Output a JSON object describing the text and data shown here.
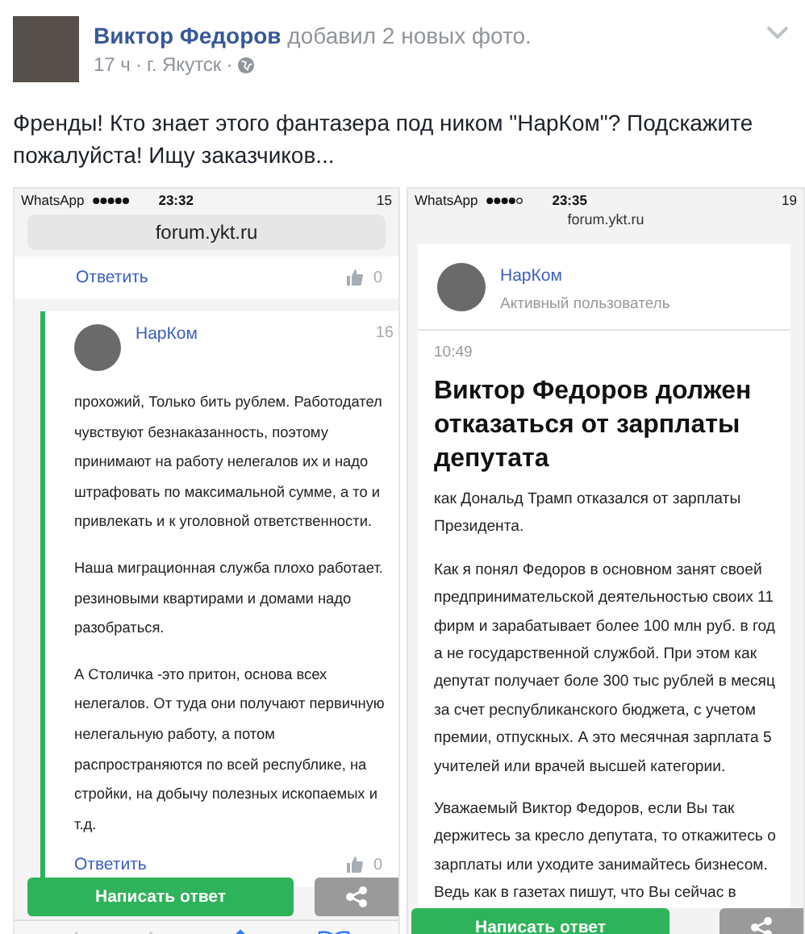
{
  "post": {
    "author": "Виктор Федоров",
    "action": "добавил 2 новых фото.",
    "time": "17 ч",
    "location": "г. Якутск",
    "separator": "·",
    "text": "Френды! Кто знает этого фантазера под ником \"НарКом\"? Подскажите пожалуйста! Ищу заказчиков..."
  },
  "left_phone": {
    "status": {
      "app": "WhatsApp",
      "time": "23:32",
      "battery": "15"
    },
    "url": "forum.ykt.ru",
    "top_reply": {
      "link": "Ответить",
      "likes": "0"
    },
    "comment": {
      "author": "НарКом",
      "date": "16",
      "paragraphs": [
        [
          "прохожий, Только бить рублем. Работодател",
          "чувствуют безнаказанность, поэтому",
          "принимают на работу нелегалов их и надо",
          "штрафовать по максимальной сумме, а то и",
          "привлекать и к уголовной ответственности."
        ],
        [
          "Наша миграционная служба плохо работает.",
          "резиновыми квартирами и домами надо",
          "разобраться."
        ],
        [
          "А Столичка -это притон, основа всех",
          "нелегалов. От туда они получают первичную",
          "нелегальную работу, а потом",
          "распространяются по всей республике, на",
          "стройки, на добычу полезных ископаемых и",
          "т.д."
        ]
      ],
      "reply": {
        "link": "Ответить",
        "likes": "0"
      }
    },
    "button": "Написать ответ"
  },
  "right_phone": {
    "status": {
      "app": "WhatsApp",
      "time": "23:35",
      "battery": "19"
    },
    "url": "forum.ykt.ru",
    "author": "НарКом",
    "role": "Активный пользователь",
    "time": "10:49",
    "headline": "Виктор Федоров должен отказаться от зарплаты депутата",
    "paragraphs": [
      [
        "как Дональд Трамп отказался от зарплаты",
        "Президента."
      ],
      [
        "Как я понял Федоров в основном занят своей",
        "предпринимательской деятельностью своих 11",
        "фирм и зарабатывает более 100 млн руб. в год",
        "а не государственной службой. При этом как",
        "депутат получает боле 300 тыс рублей в месяц",
        "за счет республиканского бюджета, с учетом",
        "премии, отпускных. А это месячная зарплата 5",
        "учителей или врачей высшей категории."
      ],
      [
        "Уважаемый Виктор Федоров, если Вы так",
        "держитесь за кресло депутата, то откажитесь о",
        "зарплаты или уходите занимайтесь бизнесом.",
        "Ведь как в газетах пишут, что Вы сейчас в"
      ]
    ],
    "button": "Написать ответ"
  }
}
